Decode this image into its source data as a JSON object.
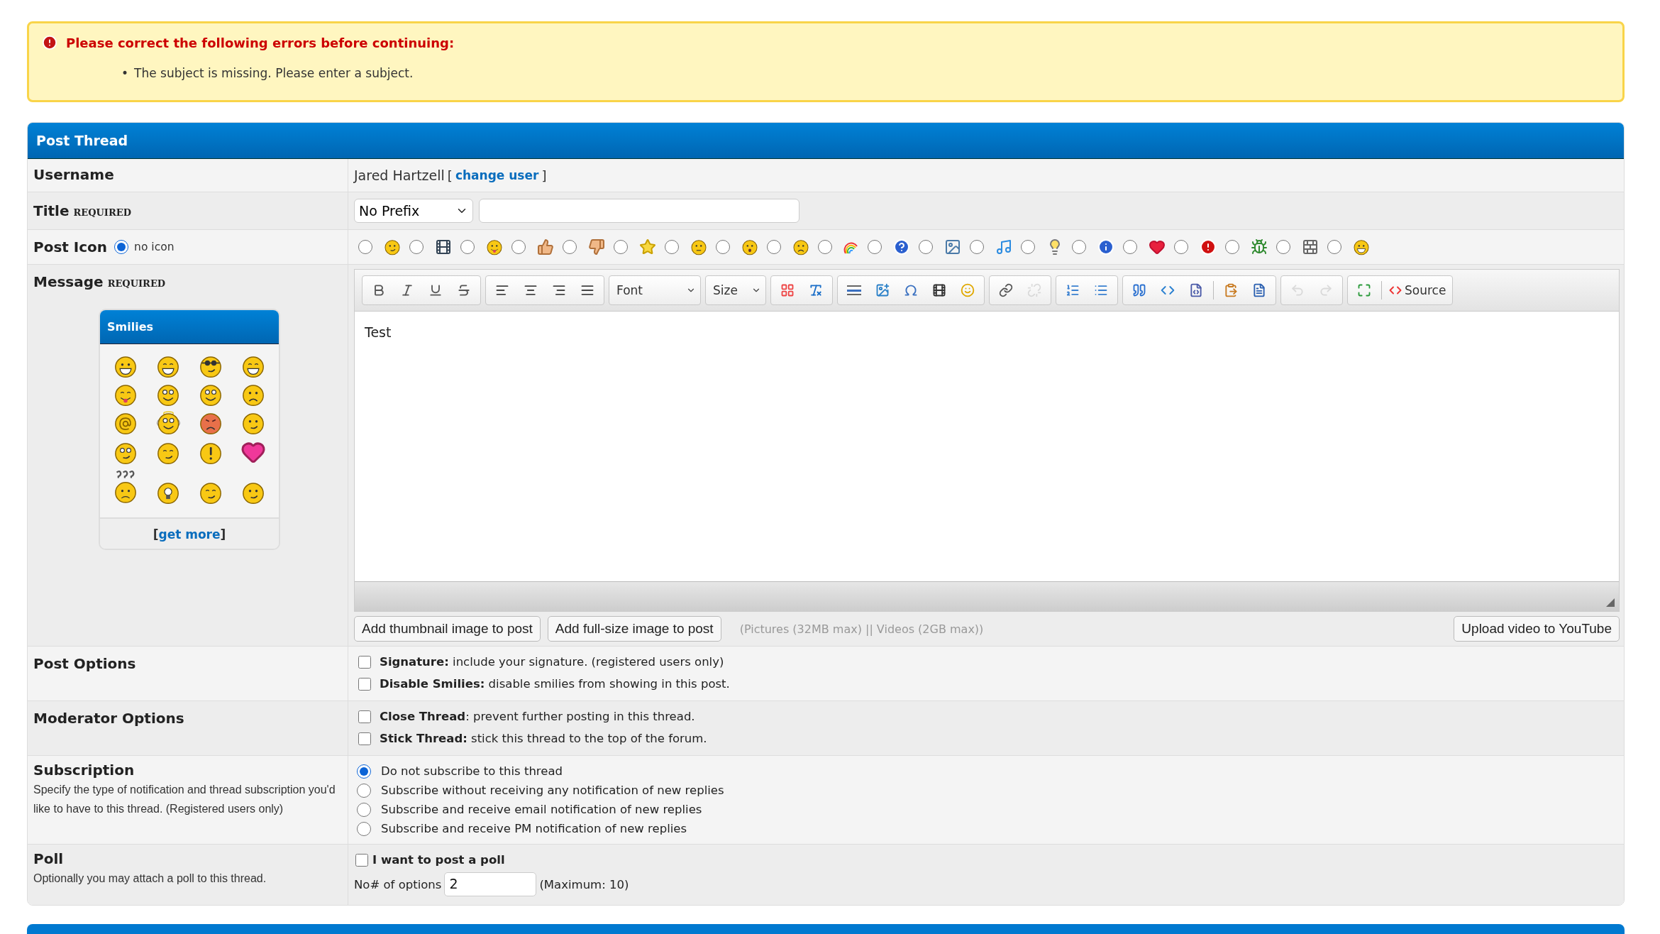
{
  "error": {
    "title": "Please correct the following errors before continuing:",
    "items": [
      {
        "marker": "•",
        "text": "The subject is missing. Please enter a subject."
      }
    ]
  },
  "panel": {
    "title": "Post Thread"
  },
  "username": {
    "label": "Username",
    "value": "Jared Hartzell",
    "bracket_open": "[",
    "link": "change user",
    "bracket_close": "]"
  },
  "title": {
    "label": "Title",
    "required": "REQUIRED",
    "prefix": "No Prefix"
  },
  "post_icon": {
    "label": "Post Icon",
    "none_label": "no icon",
    "none_selected": true,
    "icons": [
      {
        "selected": false
      },
      {
        "selected": false
      },
      {
        "selected": false
      },
      {
        "selected": false
      },
      {
        "selected": false
      },
      {
        "selected": false
      },
      {
        "selected": false
      },
      {
        "selected": false
      },
      {
        "selected": false
      },
      {
        "selected": false
      },
      {
        "selected": false
      },
      {
        "selected": false
      },
      {
        "selected": false
      },
      {
        "selected": false
      },
      {
        "selected": false
      },
      {
        "selected": false
      },
      {
        "selected": false
      },
      {
        "selected": false
      },
      {
        "selected": false
      },
      {
        "selected": false
      }
    ]
  },
  "message": {
    "label": "Message",
    "required": "REQUIRED",
    "smilies": {
      "title": "Smilies",
      "bracket_open": "[",
      "more": "get more",
      "bracket_close": "]"
    },
    "toolbar": {
      "font": "Font",
      "size": "Size",
      "source": "Source",
      "buttons": [
        {
          "disabled": false
        },
        {
          "disabled": false
        },
        {
          "disabled": false
        },
        {
          "disabled": false
        },
        {
          "disabled": false
        },
        {
          "disabled": false
        },
        {
          "disabled": false
        },
        {
          "disabled": false
        },
        {
          "disabled": false
        },
        {
          "disabled": false
        },
        {
          "disabled": false
        },
        {
          "disabled": false
        },
        {
          "disabled": false
        },
        {
          "disabled": false
        },
        {
          "disabled": false
        },
        {
          "disabled": false
        },
        {
          "disabled": true
        },
        {
          "disabled": false
        },
        {
          "disabled": false
        },
        {
          "disabled": false
        },
        {
          "disabled": false
        },
        {
          "disabled": false
        },
        {
          "disabled": false
        },
        {
          "disabled": false
        },
        {
          "disabled": true
        },
        {
          "disabled": true
        },
        {
          "disabled": false
        }
      ]
    },
    "editor_text": "Test",
    "attach_buttons": [
      "Add thumbnail image to post",
      "Add full-size image to post"
    ],
    "attach_note": "(Pictures (32MB max) || Videos (2GB max))",
    "youtube_button": "Upload video to YouTube"
  },
  "post_options": {
    "label": "Post Options",
    "options": [
      {
        "text": "**Signature:** include your signature. (registered users only)",
        "checked": false
      },
      {
        "text": "**Disable Smilies:** disable smilies from showing in this post.",
        "checked": false
      }
    ]
  },
  "moderator_options": {
    "label": "Moderator Options",
    "options": [
      {
        "text": "**Close Thread**: prevent further posting in this thread.",
        "checked": false
      },
      {
        "text": "**Stick Thread:** stick this thread to the top of the forum.",
        "checked": false
      }
    ]
  },
  "subscription": {
    "label": "Subscription",
    "description": "Specify the type of notification and thread subscription you'd like to have to this thread. (Registered users only)",
    "options": [
      {
        "text": "Do not subscribe to this thread",
        "selected": true
      },
      {
        "text": "Subscribe without receiving any notification of new replies",
        "selected": false
      },
      {
        "text": "Subscribe and receive email notification of new replies",
        "selected": false
      },
      {
        "text": "Subscribe and receive PM notification of new replies",
        "selected": false
      }
    ]
  },
  "poll": {
    "label": "Poll",
    "description": "Optionally you may attach a poll to this thread.",
    "checkbox": {
      "text": "I want to post a poll",
      "checked": false
    },
    "options_label": "No# of options",
    "options_value": "2",
    "maximum": "(Maximum: 10)"
  }
}
